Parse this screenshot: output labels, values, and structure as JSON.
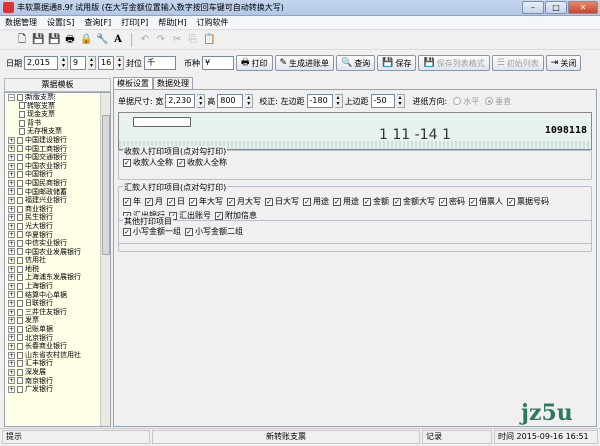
{
  "window": {
    "title": "丰软票据通8.9f 试用版 (在大写金额位置输入数字按回车键可自动转换大写)"
  },
  "menu": [
    "数据管理",
    "设置[S]",
    "查询[F]",
    "打印[P]",
    "帮助[H]",
    "订购软件"
  ],
  "toolbar1": {
    "icons": [
      "new-icon",
      "save-disk-icon",
      "save-disk-icon",
      "print-icon",
      "lock-icon",
      "tools-icon",
      "font-icon",
      "undo-icon",
      "redo-icon",
      "cut-icon",
      "copy-icon",
      "paste-icon"
    ]
  },
  "toolbar2": {
    "date_label": "日期",
    "year": "2,015",
    "month": "9",
    "day": "16",
    "face_label": "封位",
    "face_value": "千",
    "currency_label": "币种",
    "currency_value": "¥",
    "print": "打印",
    "generate": "生成进账单",
    "query": "查询",
    "save": "保存",
    "save_format": "保存列表格式",
    "init_list": "初始列表",
    "close": "关闭"
  },
  "left": {
    "header": "票据模板",
    "tree": [
      {
        "label": "新版支票",
        "level": 0,
        "expanded": true,
        "selected": true
      },
      {
        "label": "转账支票",
        "level": 1
      },
      {
        "label": "现金支票",
        "level": 1
      },
      {
        "label": "背书",
        "level": 1
      },
      {
        "label": "无存根支票",
        "level": 1
      },
      {
        "label": "中国建设银行",
        "level": 0
      },
      {
        "label": "中国工商银行",
        "level": 0
      },
      {
        "label": "中国交通银行",
        "level": 0
      },
      {
        "label": "中国农业银行",
        "level": 0
      },
      {
        "label": "中国银行",
        "level": 0
      },
      {
        "label": "中国民商银行",
        "level": 0
      },
      {
        "label": "中国邮政储蓄",
        "level": 0
      },
      {
        "label": "福建兴业银行",
        "level": 0
      },
      {
        "label": "商业银行",
        "level": 0
      },
      {
        "label": "民生银行",
        "level": 0
      },
      {
        "label": "光大银行",
        "level": 0
      },
      {
        "label": "华夏银行",
        "level": 0
      },
      {
        "label": "中信实业银行",
        "level": 0
      },
      {
        "label": "中国农业发展银行",
        "level": 0
      },
      {
        "label": "信用社",
        "level": 0
      },
      {
        "label": "地税",
        "level": 0
      },
      {
        "label": "上海浦东发展银行",
        "level": 0
      },
      {
        "label": "上海银行",
        "level": 0
      },
      {
        "label": "结算中心单据",
        "level": 0
      },
      {
        "label": "日联银行",
        "level": 0
      },
      {
        "label": "三井住友银行",
        "level": 0
      },
      {
        "label": "发票",
        "level": 0
      },
      {
        "label": "记账单据",
        "level": 0
      },
      {
        "label": "北京银行",
        "level": 0
      },
      {
        "label": "长春商业银行",
        "level": 0
      },
      {
        "label": "山东省农村信用社",
        "level": 0
      },
      {
        "label": "汇丰银行",
        "level": 0
      },
      {
        "label": "深发展",
        "level": 0
      },
      {
        "label": "南京银行",
        "level": 0
      },
      {
        "label": "广发银行",
        "level": 0
      }
    ]
  },
  "right": {
    "tabs": [
      "模板设置",
      "数据处理"
    ],
    "size_label": "单据尺寸: 宽",
    "width": "2,230",
    "height_label": "高",
    "height": "800",
    "calib_label": "校正: 左边距",
    "left_margin": "-180",
    "top_label": "上边距",
    "top_margin": "-50",
    "direction_label": "进纸方向:",
    "horizontal": "水平",
    "vertical": "垂直",
    "preview_number": "1098118",
    "preview_big": "1 11 -14 1",
    "group1": {
      "title": "收款人打印项目(点对勾打印)",
      "items": [
        "收款人全称",
        "收款人全称"
      ]
    },
    "group2": {
      "title": "汇款人打印项目(点对勾打印)",
      "items": [
        "年",
        "月",
        "日",
        "年大写",
        "月大写",
        "日大写",
        "用途",
        "用途",
        "金额",
        "金额大写",
        "密码",
        "借票人",
        "票据号码",
        "汇出银行",
        "汇出账号",
        "附加信息"
      ]
    },
    "group3": {
      "title": "其他打印项目",
      "items": [
        "小写金额一组",
        "小写金额二组"
      ]
    }
  },
  "status": {
    "hint": "提示",
    "template": "新转账支票",
    "record": "记录",
    "time": "时间",
    "time_value": "2015-09-16 16:51"
  },
  "watermark": "jz5u"
}
